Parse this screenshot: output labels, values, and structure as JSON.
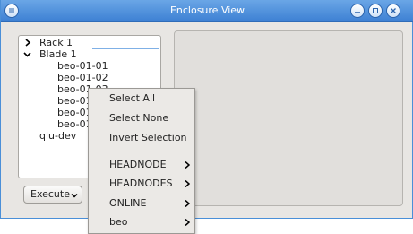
{
  "window": {
    "title": "Enclosure View"
  },
  "tree": {
    "items": [
      {
        "label": "Rack 1",
        "expander": "collapsed"
      },
      {
        "label": "Blade 1",
        "expander": "expanded"
      },
      {
        "label": "beo-01-01"
      },
      {
        "label": "beo-01-02"
      },
      {
        "label": "beo-01-03"
      },
      {
        "label": "beo-01-04"
      },
      {
        "label": "beo-01-05"
      },
      {
        "label": "beo-01-06"
      },
      {
        "label": "qlu-dev"
      }
    ]
  },
  "execute_button": {
    "label": "Execute"
  },
  "context_menu": {
    "actions": [
      {
        "label": "Select All"
      },
      {
        "label": "Select None"
      },
      {
        "label": "Invert Selection"
      }
    ],
    "submenus": [
      {
        "label": "HEADNODE"
      },
      {
        "label": "HEADNODES"
      },
      {
        "label": "ONLINE"
      },
      {
        "label": "beo"
      }
    ]
  },
  "colors": {
    "titlebar": "#3f82d4",
    "window_bg": "#e8e6e3",
    "menu_bg": "#ebe9e6"
  }
}
